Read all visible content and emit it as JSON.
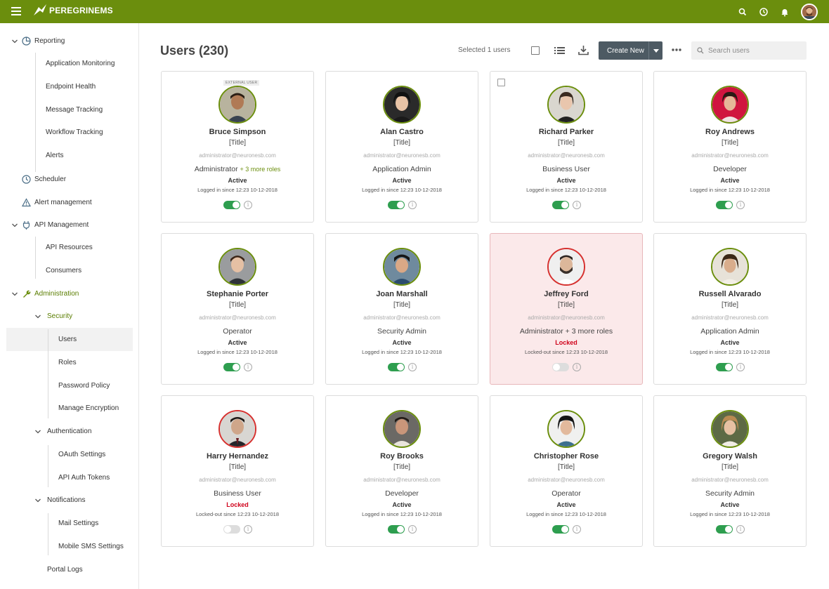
{
  "app": {
    "brand": "PEREGRINEMS"
  },
  "sidebar": {
    "items": [
      {
        "label": "Reporting"
      },
      {
        "label": "Application Monitoring"
      },
      {
        "label": "Endpoint Health"
      },
      {
        "label": "Message Tracking"
      },
      {
        "label": "Workflow Tracking"
      },
      {
        "label": "Alerts"
      },
      {
        "label": "Scheduler"
      },
      {
        "label": "Alert management"
      },
      {
        "label": "API Management"
      },
      {
        "label": "API Resources"
      },
      {
        "label": "Consumers"
      },
      {
        "label": "Administration"
      },
      {
        "label": "Security"
      },
      {
        "label": "Users"
      },
      {
        "label": "Roles"
      },
      {
        "label": "Password Policy"
      },
      {
        "label": "Manage Encryption"
      },
      {
        "label": "Authentication"
      },
      {
        "label": "OAuth Settings"
      },
      {
        "label": "API Auth Tokens"
      },
      {
        "label": "Notifications"
      },
      {
        "label": "Mail Settings"
      },
      {
        "label": "Mobile SMS Settings"
      },
      {
        "label": "Portal Logs"
      }
    ]
  },
  "header": {
    "title": "Users (230)",
    "selected": "Selected 1 users",
    "create_label": "Create New",
    "search_placeholder": "Search users"
  },
  "cards": [
    {
      "badge": "EXTERNAL USER",
      "name": "Bruce Simpson",
      "title": "[Title]",
      "email": "administrator@neuronesb.com",
      "role": "Administrator",
      "more": "+ 3 more roles",
      "status": "Active",
      "since": "Logged in since 12:23 10-12-2018"
    },
    {
      "name": "Alan Castro",
      "title": "[Title]",
      "email": "administrator@neuronesb.com",
      "role": "Application Admin",
      "status": "Active",
      "since": "Logged in since 12:23 10-12-2018"
    },
    {
      "name": "Richard Parker",
      "title": "[Title]",
      "email": "administrator@neuronesb.com",
      "role": "Business User",
      "status": "Active",
      "since": "Logged in since 12:23 10-12-2018"
    },
    {
      "name": "Roy Andrews",
      "title": "[Title]",
      "email": "administrator@neuronesb.com",
      "role": "Developer",
      "status": "Active",
      "since": "Logged in since 12:23 10-12-2018"
    },
    {
      "name": "Stephanie Porter",
      "title": "[Title]",
      "email": "administrator@neuronesb.com",
      "role": "Operator",
      "status": "Active",
      "since": "Logged in since 12:23 10-12-2018"
    },
    {
      "name": "Joan Marshall",
      "title": "[Title]",
      "email": "administrator@neuronesb.com",
      "role": "Security Admin",
      "status": "Active",
      "since": "Logged in since 12:23 10-12-2018"
    },
    {
      "name": "Jeffrey Ford",
      "title": "[Title]",
      "email": "administrator@neuronesb.com",
      "role": "Administrator + 3 more roles",
      "status": "Locked",
      "since": "Locked-out since 12:23 10-12-2018"
    },
    {
      "name": "Russell Alvarado",
      "title": "[Title]",
      "email": "administrator@neuronesb.com",
      "role": "Application Admin",
      "status": "Active",
      "since": "Logged in since 12:23 10-12-2018"
    },
    {
      "name": "Harry Hernandez",
      "title": "[Title]",
      "email": "administrator@neuronesb.com",
      "role": "Business User",
      "status": "Locked",
      "since": "Locked-out since 12:23 10-12-2018"
    },
    {
      "name": "Roy Brooks",
      "title": "[Title]",
      "email": "administrator@neuronesb.com",
      "role": "Developer",
      "status": "Active",
      "since": "Logged in since 12:23 10-12-2018"
    },
    {
      "name": "Christopher Rose",
      "title": "[Title]",
      "email": "administrator@neuronesb.com",
      "role": "Operator",
      "status": "Active",
      "since": "Logged in since 12:23 10-12-2018"
    },
    {
      "name": "Gregory Walsh",
      "title": "[Title]",
      "email": "administrator@neuronesb.com",
      "role": "Security Admin",
      "status": "Active",
      "since": "Logged in since 12:23 10-12-2018"
    }
  ],
  "colors": {
    "brand": "#6b8e0d",
    "active_toggle": "#2e9e4f",
    "locked": "#d0021b",
    "locked_card_bg": "#fbe9ea"
  },
  "icons": [
    "menu-icon",
    "logo-bird-icon",
    "search-icon",
    "clock-icon",
    "bell-icon",
    "list-view-icon",
    "download-icon",
    "more-icon",
    "info-icon"
  ]
}
